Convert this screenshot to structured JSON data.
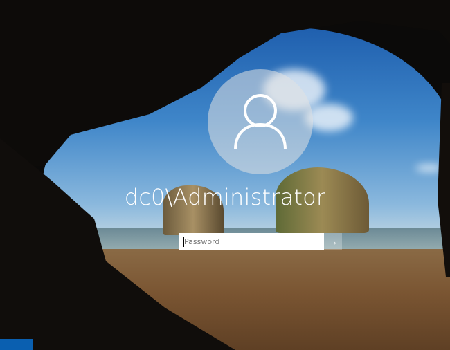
{
  "user": {
    "name": "dc0\\Administrator",
    "avatar_icon": "user-icon"
  },
  "password": {
    "placeholder": "Password",
    "value": "",
    "submit_icon": "arrow-right-icon",
    "submit_glyph": "→"
  },
  "colors": {
    "accent": "#0a5fb0"
  }
}
